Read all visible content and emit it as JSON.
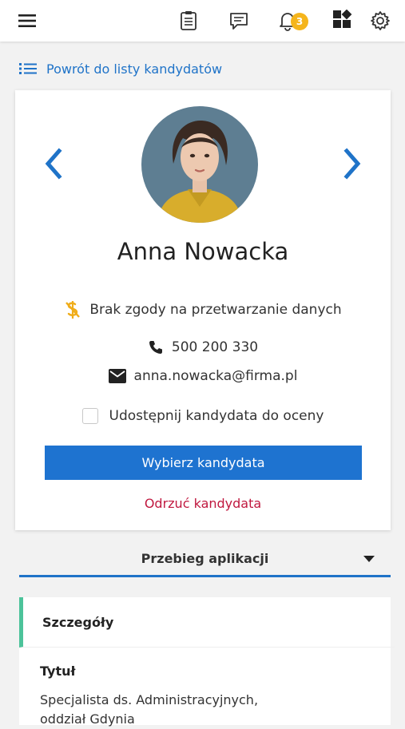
{
  "topbar": {
    "menu_icon": "hamburger-icon",
    "icons": [
      "clipboard-icon",
      "chat-icon",
      "bell-icon",
      "apps-icon",
      "gear-icon"
    ],
    "notification_count": "3"
  },
  "back_link": {
    "label": "Powrót do listy kandydatów",
    "icon": "list-icon"
  },
  "candidate": {
    "name": "Anna Nowacka",
    "consent_status": "Brak zgody na przetwarzanie danych",
    "phone": "500 200 330",
    "email": "anna.nowacka@firma.pl",
    "share_checkbox_label": "Udostępnij kandydata do oceny",
    "share_checked": false,
    "select_button": "Wybierz kandydata",
    "reject_link": "Odrzuć kandydata"
  },
  "application_section": {
    "title": "Przebieg aplikacji"
  },
  "details": {
    "title": "Szczegóły",
    "field_label": "Tytuł",
    "field_value": "Specjalista ds. Administracyjnych, oddział Gdynia"
  },
  "colors": {
    "accent": "#1f73c8",
    "primary_button": "#1e73d0",
    "reject": "#c0183f",
    "badge": "#f5b51c",
    "details_border": "#4cc39a"
  }
}
